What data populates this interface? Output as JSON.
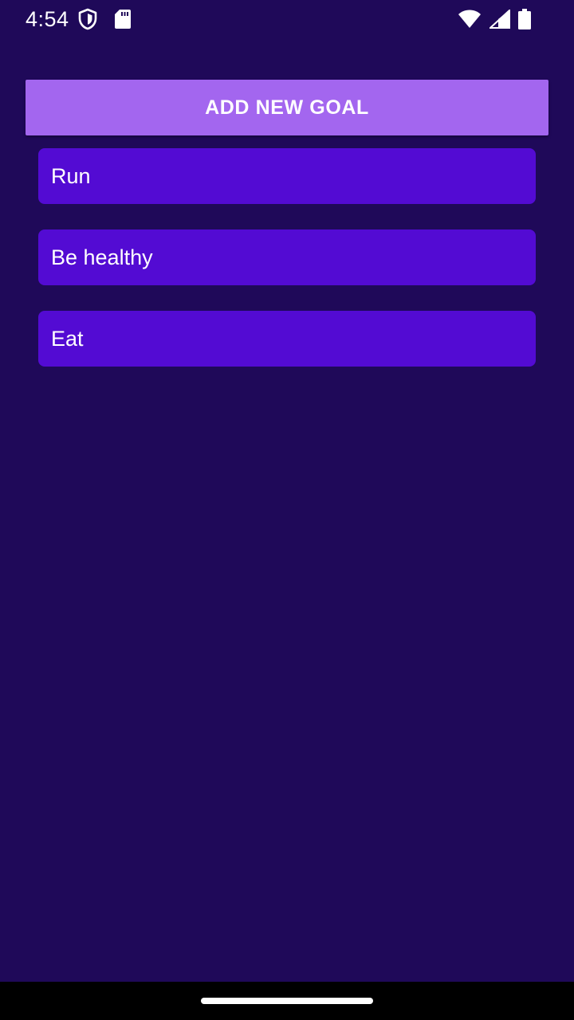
{
  "status_bar": {
    "time": "4:54",
    "icons": [
      "shield-icon",
      "sd-card-icon",
      "wifi-icon",
      "signal-icon",
      "battery-icon"
    ]
  },
  "colors": {
    "background": "#1f0959",
    "button": "#a366ef",
    "goal_item": "#530bd3",
    "nav_bar": "#000000"
  },
  "main": {
    "add_goal_label": "ADD NEW GOAL",
    "goals": [
      {
        "label": "Run"
      },
      {
        "label": "Be healthy"
      },
      {
        "label": "Eat"
      }
    ]
  }
}
